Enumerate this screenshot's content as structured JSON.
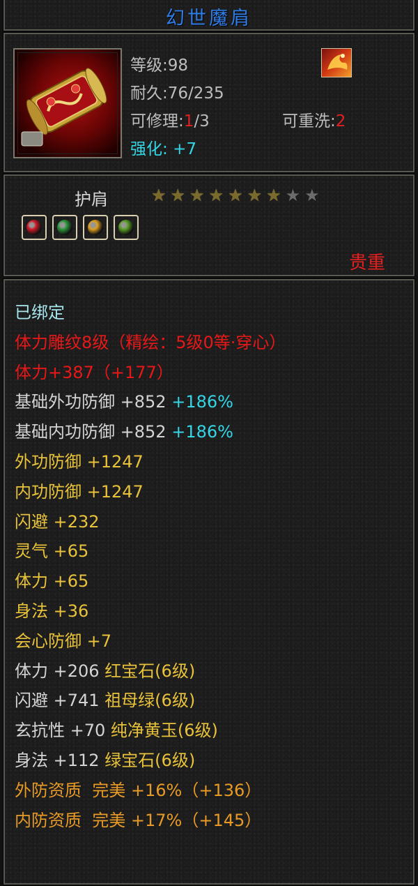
{
  "item": {
    "name": "幻世魔肩",
    "level_label": "等级",
    "level_value": "98",
    "durability_label": "耐久",
    "durability_value": "76/235",
    "repair_label": "可修理",
    "repair_used": "1",
    "repair_max": "/3",
    "reroll_label": "可重洗",
    "reroll_value": "2",
    "enhance_label": "强化",
    "enhance_value": "+7",
    "type": "护肩",
    "stars_total": 9,
    "stars_filled": 7,
    "rarity": "贵重",
    "colon": ":"
  },
  "sockets": [
    {
      "icon": "red-gem-icon",
      "color": "#d21c2a"
    },
    {
      "icon": "green-gem-icon",
      "color": "#2e9a3a"
    },
    {
      "icon": "yellow-gem-icon",
      "color": "#e0a020"
    },
    {
      "icon": "emerald-gem-icon",
      "color": "#5aa024"
    }
  ],
  "attributes": [
    {
      "text": "已绑定",
      "color": "cyanish"
    },
    {
      "text": "体力雕纹8级（精绘：5级0等·穿心）",
      "color": "red"
    },
    {
      "text": "体力+387（+177）",
      "color": "red"
    },
    {
      "text": "基础外功防御 +852 ",
      "extra": "+186%",
      "color": "white"
    },
    {
      "text": "基础内功防御 +852 ",
      "extra": "+186%",
      "color": "white"
    },
    {
      "text": "外功防御 +1247",
      "color": "gold"
    },
    {
      "text": "内功防御 +1247",
      "color": "gold"
    },
    {
      "text": "闪避 +232",
      "color": "gold"
    },
    {
      "text": "灵气 +65",
      "color": "gold"
    },
    {
      "text": "体力 +65",
      "color": "gold"
    },
    {
      "text": "身法 +36",
      "color": "gold"
    },
    {
      "text": "会心防御 +7",
      "color": "gold"
    },
    {
      "text": "体力 +206 ",
      "gem": "红宝石(6级)",
      "color": "white"
    },
    {
      "text": "闪避 +741 ",
      "gem": "祖母绿(6级)",
      "color": "white"
    },
    {
      "text": "玄抗性 +70 ",
      "gem": "纯净黄玉(6级)",
      "color": "white"
    },
    {
      "text": "身法 +112 ",
      "gem": "绿宝石(6级)",
      "color": "white"
    },
    {
      "text": "外防资质  完美 +16%（+136）",
      "color": "orange"
    },
    {
      "text": "内防资质  完美 +17%（+145）",
      "color": "orange"
    }
  ],
  "colors": {
    "title": "#2f7de8",
    "red": "#e81818",
    "gold": "#e8c23a",
    "orange": "#e89a26",
    "cyan": "#34d6e6"
  }
}
